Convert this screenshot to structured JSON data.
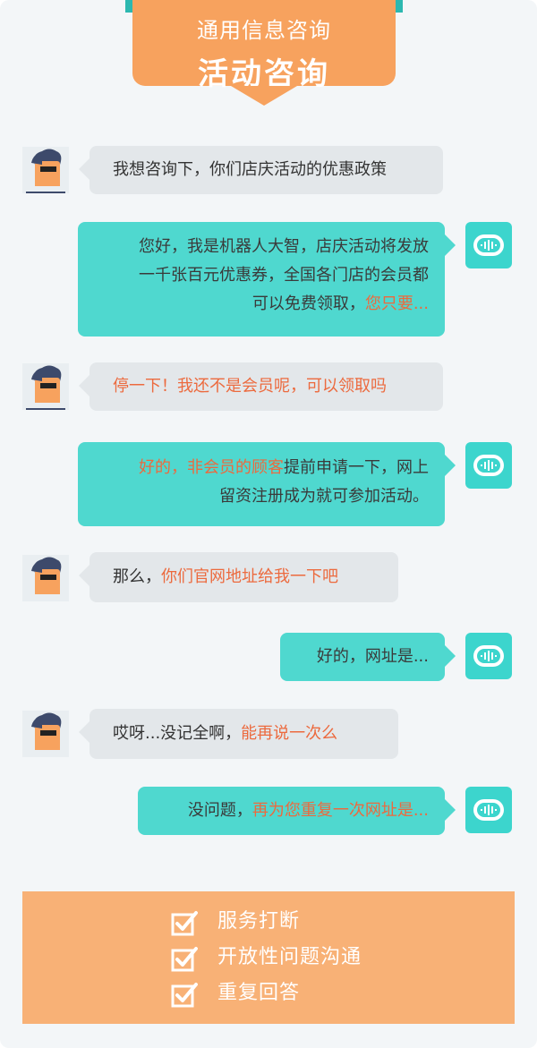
{
  "header": {
    "subtitle": "通用信息咨询",
    "title": "活动咨询"
  },
  "colors": {
    "accent_orange": "#f7a25e",
    "bot_teal": "#4fd8cf",
    "highlight": "#ec6a3e",
    "user_bubble": "#e3e7ea"
  },
  "messages": [
    {
      "sender": "user",
      "icon": "user-avatar-icon",
      "parts": [
        {
          "text": "我想咨询下，你们店庆活动的优惠政策",
          "hl": false
        }
      ]
    },
    {
      "sender": "bot",
      "icon": "robot-voice-icon",
      "lines": [
        [
          {
            "text": "您好，我是机器人大智，店庆活动将发放",
            "hl": false
          }
        ],
        [
          {
            "text": "一千张百元优惠券，全国各门店的会员都",
            "hl": false
          }
        ],
        [
          {
            "text": "可以免费领取，",
            "hl": false
          },
          {
            "text": "您只要...",
            "hl": true
          }
        ]
      ]
    },
    {
      "sender": "user",
      "icon": "user-avatar-icon",
      "parts": [
        {
          "text": "停一下！我还不是会员呢，可以领取吗",
          "hl": true
        }
      ]
    },
    {
      "sender": "bot",
      "icon": "robot-voice-icon",
      "lines": [
        [
          {
            "text": "好的，非会员的顾客",
            "hl": true
          },
          {
            "text": "提前申请一下，网上",
            "hl": false
          }
        ],
        [
          {
            "text": "留资注册成为就可参加活动。",
            "hl": false
          }
        ]
      ]
    },
    {
      "sender": "user",
      "icon": "user-avatar-icon",
      "parts": [
        {
          "text": "那么，",
          "hl": false
        },
        {
          "text": "你们官网地址给我一下吧",
          "hl": true
        }
      ]
    },
    {
      "sender": "bot",
      "icon": "robot-voice-icon",
      "lines": [
        [
          {
            "text": "好的，网址是...",
            "hl": false
          }
        ]
      ]
    },
    {
      "sender": "user",
      "icon": "user-avatar-icon",
      "parts": [
        {
          "text": "哎呀...没记全啊，",
          "hl": false
        },
        {
          "text": "能再说一次么",
          "hl": true
        }
      ]
    },
    {
      "sender": "bot",
      "icon": "robot-voice-icon",
      "lines": [
        [
          {
            "text": "没问题，",
            "hl": false
          },
          {
            "text": "再为您重复一次网址是...",
            "hl": true
          }
        ]
      ]
    }
  ],
  "summary": {
    "items": [
      {
        "label": "服务打断",
        "icon": "check-icon"
      },
      {
        "label": "开放性问题沟通",
        "icon": "check-icon"
      },
      {
        "label": "重复回答",
        "icon": "check-icon"
      }
    ]
  }
}
